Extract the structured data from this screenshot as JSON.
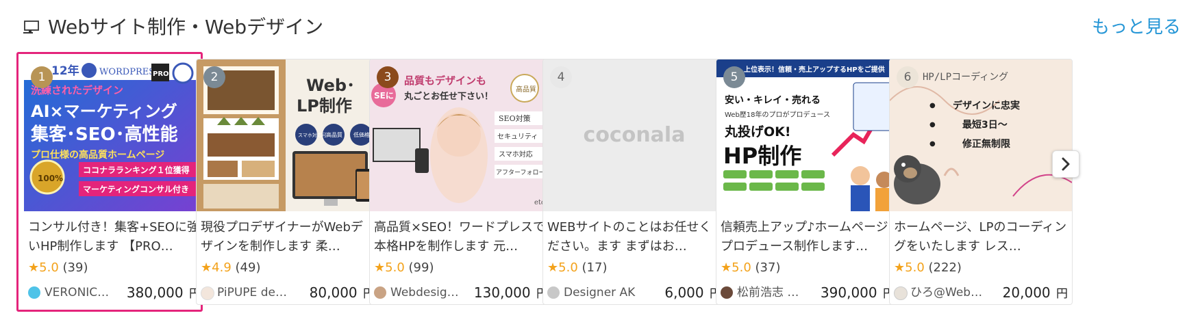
{
  "section": {
    "title": "Webサイト制作・Webデザイン",
    "more_label": "もっと見る"
  },
  "cards": [
    {
      "rank": "1",
      "title": "コンサル付き！集客+SEOに強いHP制作します 【PRO…",
      "rating_star": "★",
      "rating": "5.0",
      "reviews": "(39)",
      "seller": "VERONIC…",
      "price": "380,000",
      "yen": "円",
      "thumb_text": {
        "l1": "12年",
        "wp": "WORDPRESS",
        "pro": "PRO",
        "l2": "洗練されたデザイン",
        "l3": "AI×マーケティング",
        "l4": "集客･SEO･高性能",
        "l5": "プロ仕様の高品質ホームページ",
        "l6": "ココナラランキング１位獲得",
        "l7": "マーケティングコンサル付き",
        "badge": "100%"
      }
    },
    {
      "rank": "2",
      "title": "現役プロデザイナーがWebデザインを制作します 柔…",
      "rating_star": "★",
      "rating": "4.9",
      "reviews": "(49)",
      "seller": "PiPUPE desi…",
      "price": "80,000",
      "yen": "円",
      "thumb_text": {
        "l1": "Web･",
        "l2": "LP制作",
        "b1": "スマホ対応可",
        "b2": "高品質",
        "b3": "低価格"
      }
    },
    {
      "rank": "3",
      "title": "高品質×SEO！ワードプレスで本格HPを制作します 元…",
      "rating_star": "★",
      "rating": "5.0",
      "reviews": "(99)",
      "seller": "Webdesig…",
      "price": "130,000",
      "yen": "円",
      "thumb_text": {
        "l1": "品質もデザインも",
        "l2": "丸ごとお任せ下さい！",
        "se": "SEに",
        "seal": "高品質",
        "i1": "SEO対策",
        "i2": "セキュリティ",
        "i3": "スマホ対応",
        "i4": "アフターフォロー",
        "etc": "etc."
      }
    },
    {
      "rank": "4",
      "title": "WEBサイトのことはお任せください。ます まずはお…",
      "rating_star": "★",
      "rating": "5.0",
      "reviews": "(17)",
      "seller": "Designer AK",
      "price": "6,000",
      "yen": "円",
      "thumb_text": {
        "logo": "coconala"
      }
    },
    {
      "rank": "5",
      "title": "信頼売上アップ♪ホームページプロデュース制作します…",
      "rating_star": "★",
      "rating": "5.0",
      "reviews": "(37)",
      "seller": "松前浩志 …",
      "price": "390,000",
      "yen": "円",
      "thumb_text": {
        "top": "上位表示！信頼・売上アップするHPをご提供",
        "l1": "安い・キレイ・売れる",
        "l2": "Web歴18年のプロがプロデュース",
        "l3": "丸投げOK!",
        "l4": "HP制作"
      }
    },
    {
      "rank": "6",
      "title": "ホームページ、LPのコーディングをいたします レス…",
      "rating_star": "★",
      "rating": "5.0",
      "reviews": "(222)",
      "seller": "ひろ@Web…",
      "price": "20,000",
      "yen": "円",
      "thumb_text": {
        "l1": "HP/LPコーディング",
        "p1": "デザインに忠実",
        "p2": "最短3日〜",
        "p3": "修正無制限"
      }
    }
  ],
  "colors": {
    "accent_link": "#2596d6",
    "selection": "#e4247b",
    "star": "#f3a21b"
  },
  "icons": {
    "section": "monitor-icon",
    "next": "chevron-right-icon",
    "star": "star-icon"
  }
}
